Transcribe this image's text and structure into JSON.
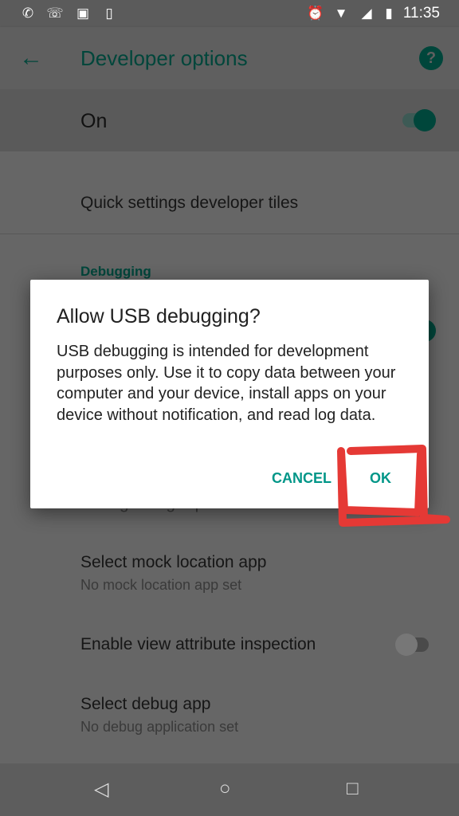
{
  "status_bar": {
    "time": "11:35",
    "left_icons": [
      "whatsapp-icon",
      "missed-call-icon",
      "image-icon",
      "phone-alert-icon"
    ],
    "right_icons": [
      "alarm-icon",
      "wifi-icon",
      "signal-icon",
      "battery-charging-icon"
    ]
  },
  "app_bar": {
    "title": "Developer options",
    "back_icon": "arrow-back-icon",
    "help_icon": "help-icon"
  },
  "master_switch": {
    "label": "On",
    "on": true
  },
  "list": {
    "quick_settings": "Quick settings developer tiles",
    "debugging_header": "Debugging",
    "bug_report_partial": "Taking a bug report",
    "mock_location": {
      "title": "Select mock location app",
      "subtitle": "No mock location app set"
    },
    "view_attr": {
      "title": "Enable view attribute inspection",
      "on": false
    },
    "debug_app": {
      "title": "Select debug app",
      "subtitle": "No debug application set"
    }
  },
  "dialog": {
    "title": "Allow USB debugging?",
    "body": "USB debugging is intended for development purposes only. Use it to copy data between your computer and your device, install apps on your device without notification, and read log data.",
    "cancel": "CANCEL",
    "ok": "OK"
  },
  "colors": {
    "accent": "#009688",
    "accent_dim": "#00463b",
    "annotation": "#e53935"
  }
}
